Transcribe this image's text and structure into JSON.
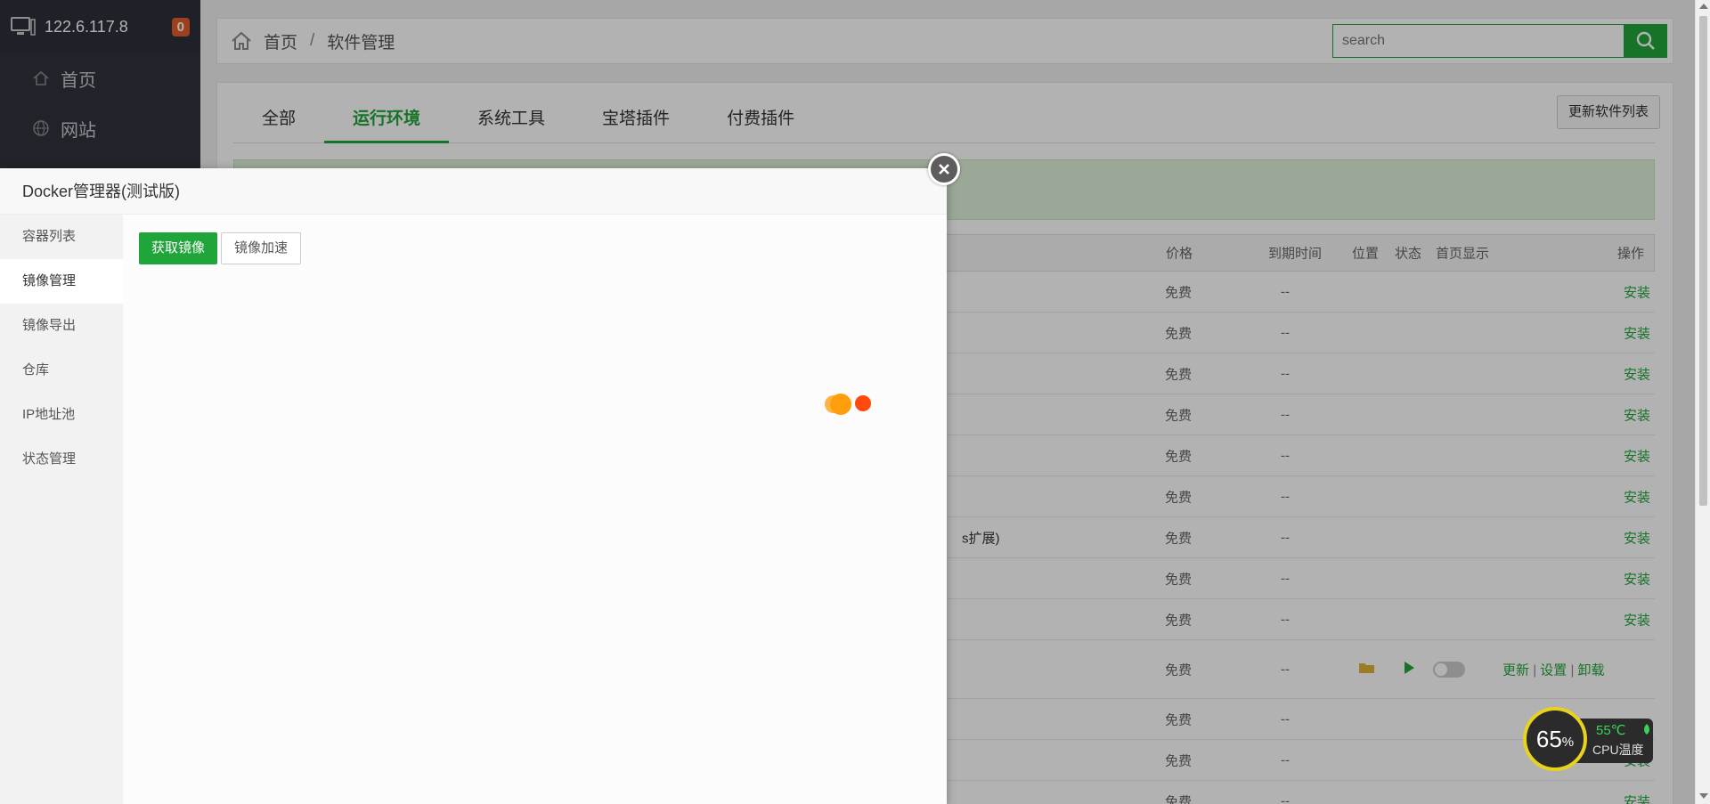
{
  "sidebar": {
    "ip": "122.6.117.8",
    "badge": "0",
    "items": [
      {
        "label": "首页",
        "icon": "home-icon"
      },
      {
        "label": "网站",
        "icon": "globe-icon"
      }
    ]
  },
  "header": {
    "breadcrumb": [
      "首页",
      "软件管理"
    ],
    "separator": "/",
    "search_placeholder": "search"
  },
  "tabs": [
    {
      "label": "全部",
      "active": false
    },
    {
      "label": "运行环境",
      "active": true
    },
    {
      "label": "系统工具",
      "active": false
    },
    {
      "label": "宝塔插件",
      "active": false
    },
    {
      "label": "付费插件",
      "active": false
    }
  ],
  "refresh_button": "更新软件列表",
  "table": {
    "headers": {
      "price": "价格",
      "expire": "到期时间",
      "location": "位置",
      "status": "状态",
      "homepage": "首页显示",
      "action": "操作"
    },
    "fragment": "s扩展)",
    "rows": [
      {
        "price": "免费",
        "expire": "--",
        "action": "安装"
      },
      {
        "price": "免费",
        "expire": "--",
        "action": "安装"
      },
      {
        "price": "免费",
        "expire": "--",
        "action": "安装"
      },
      {
        "price": "免费",
        "expire": "--",
        "action": "安装"
      },
      {
        "price": "免费",
        "expire": "--",
        "action": "安装"
      },
      {
        "price": "免费",
        "expire": "--",
        "action": "安装"
      },
      {
        "price": "免费",
        "expire": "--",
        "action": "安装"
      },
      {
        "price": "免费",
        "expire": "--",
        "action": "安装"
      },
      {
        "price": "免费",
        "expire": "--",
        "action": "安装"
      },
      {
        "price": "免费",
        "expire": "--",
        "action": "",
        "ops": [
          "更新",
          "设置",
          "卸载"
        ],
        "pipe": "|"
      },
      {
        "price": "免费",
        "expire": "--",
        "action": ""
      },
      {
        "price": "免费",
        "expire": "--",
        "action": "安装"
      },
      {
        "price": "免费",
        "expire": "--",
        "action": "安装"
      }
    ]
  },
  "modal": {
    "title": "Docker管理器(测试版)",
    "menu": [
      {
        "label": "容器列表",
        "active": false
      },
      {
        "label": "镜像管理",
        "active": true
      },
      {
        "label": "镜像导出",
        "active": false
      },
      {
        "label": "仓库",
        "active": false
      },
      {
        "label": "IP地址池",
        "active": false
      },
      {
        "label": "状态管理",
        "active": false
      }
    ],
    "buttons": {
      "pull": "获取镜像",
      "accelerate": "镜像加速"
    }
  },
  "cpu_widget": {
    "percent": "65",
    "unit": "%",
    "temp": "55℃",
    "label": "CPU温度"
  },
  "colors": {
    "accent": "#20a53a",
    "sidebar_bg": "#2f343d",
    "badge": "#e35b2a",
    "loader_orange": "#ff9e0d",
    "loader_red": "#ff4a0d"
  }
}
